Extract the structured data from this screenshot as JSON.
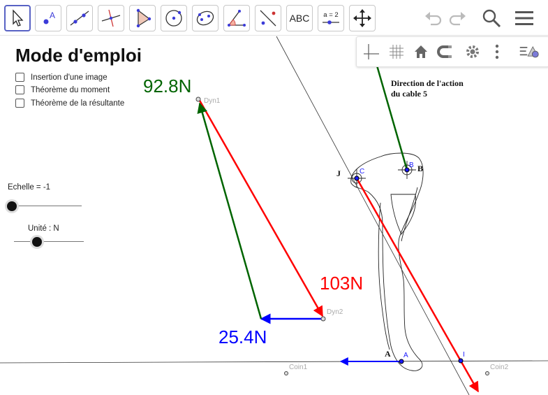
{
  "toolbar": {
    "tools": [
      {
        "name": "move-tool",
        "selected": true
      },
      {
        "name": "point-tool",
        "label": "A"
      },
      {
        "name": "line-tool"
      },
      {
        "name": "perpendicular-line-tool"
      },
      {
        "name": "polygon-tool"
      },
      {
        "name": "circle-tool"
      },
      {
        "name": "ellipse-tool"
      },
      {
        "name": "angle-tool"
      },
      {
        "name": "reflect-tool"
      },
      {
        "name": "text-tool",
        "label": "ABC"
      },
      {
        "name": "slider-tool",
        "label": "a = 2"
      },
      {
        "name": "move-graphics-tool"
      }
    ],
    "right_buttons": [
      "undo-icon",
      "redo-icon",
      "search-icon",
      "menu-icon"
    ]
  },
  "style_bar": [
    "axes-icon",
    "grid-icon",
    "home-icon",
    "magnet-icon",
    "gear-icon",
    "more-icon",
    "style-bar-toggle-icon"
  ],
  "panel": {
    "title": "Mode d'emploi",
    "checkboxes": [
      {
        "label": "Insertion d'une image",
        "checked": false
      },
      {
        "label": "Théorème du moment",
        "checked": false
      },
      {
        "label": "Théorème de la résultante",
        "checked": false
      }
    ],
    "sliders": [
      {
        "label": "Echelle = -1",
        "value": 0
      },
      {
        "label": "Unité : N",
        "value": 0.35
      }
    ]
  },
  "drawing": {
    "forces": {
      "green": {
        "label": "92.8N",
        "color": "#006400"
      },
      "red": {
        "label": "103N",
        "color": "#ff0000"
      },
      "blue": {
        "label": "25.4N",
        "color": "#0000ff"
      }
    },
    "point_labels": {
      "dyn1": "Dyn1",
      "dyn2": "Dyn2",
      "coin1": "Coin1",
      "coin2": "Coin2",
      "c": "C",
      "b": "B",
      "a": "A",
      "i": "I"
    },
    "image_labels": {
      "direction": "Direction de l'action",
      "cable": "du cable 5",
      "j": "J",
      "b": "B",
      "a": "A"
    }
  }
}
